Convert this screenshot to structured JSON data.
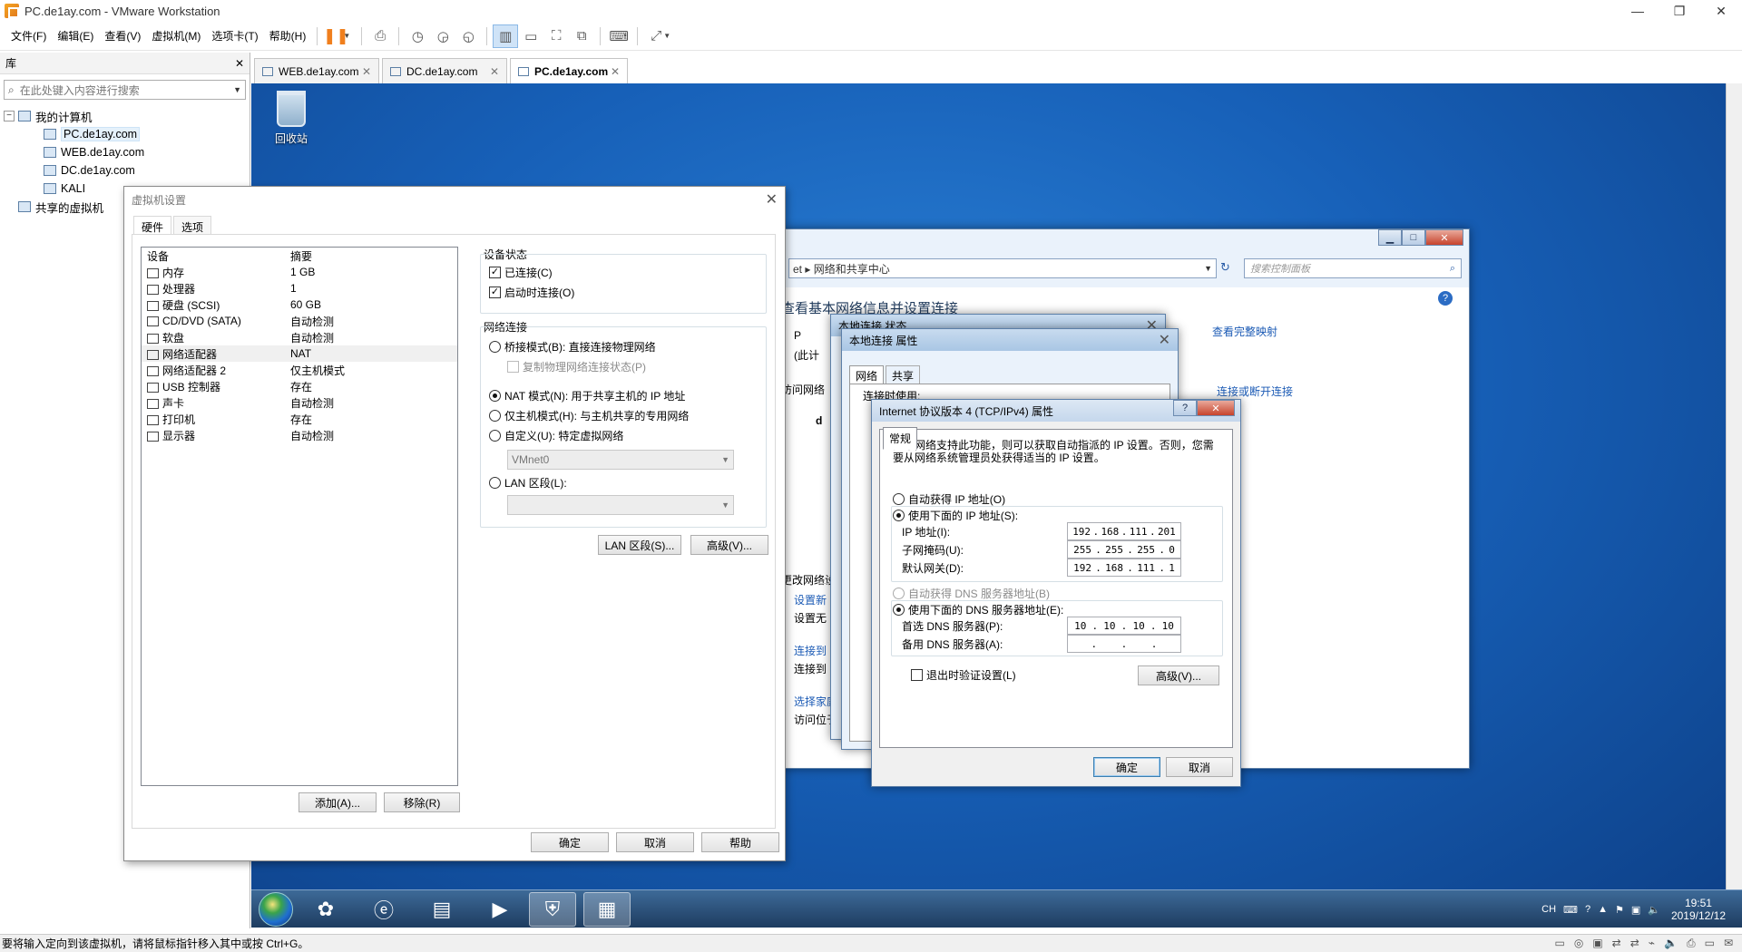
{
  "window": {
    "title": "PC.de1ay.com - VMware Workstation"
  },
  "menu": [
    "文件(F)",
    "编辑(E)",
    "查看(V)",
    "虚拟机(M)",
    "选项卡(T)",
    "帮助(H)"
  ],
  "library": {
    "title": "库",
    "search_placeholder": "在此处键入内容进行搜索",
    "root": "我的计算机",
    "vms": [
      "PC.de1ay.com",
      "WEB.de1ay.com",
      "DC.de1ay.com",
      "KALI"
    ],
    "shared": "共享的虚拟机"
  },
  "tabs": [
    "WEB.de1ay.com",
    "DC.de1ay.com",
    "PC.de1ay.com"
  ],
  "desktop": {
    "recycle_bin": "回收站"
  },
  "vm_settings": {
    "title": "虚拟机设置",
    "tabs": [
      "硬件",
      "选项"
    ],
    "col_device": "设备",
    "col_summary": "摘要",
    "devices": [
      {
        "name": "内存",
        "summary": "1 GB"
      },
      {
        "name": "处理器",
        "summary": "1"
      },
      {
        "name": "硬盘 (SCSI)",
        "summary": "60 GB"
      },
      {
        "name": "CD/DVD (SATA)",
        "summary": "自动检测"
      },
      {
        "name": "软盘",
        "summary": "自动检测"
      },
      {
        "name": "网络适配器",
        "summary": "NAT"
      },
      {
        "name": "网络适配器 2",
        "summary": "仅主机模式"
      },
      {
        "name": "USB 控制器",
        "summary": "存在"
      },
      {
        "name": "声卡",
        "summary": "自动检测"
      },
      {
        "name": "打印机",
        "summary": "存在"
      },
      {
        "name": "显示器",
        "summary": "自动检测"
      }
    ],
    "device_status": "设备状态",
    "connected": "已连接(C)",
    "connect_at_power_on": "启动时连接(O)",
    "net_conn": "网络连接",
    "bridged": "桥接模式(B): 直接连接物理网络",
    "replicate": "复制物理网络连接状态(P)",
    "nat": "NAT 模式(N): 用于共享主机的 IP 地址",
    "hostonly": "仅主机模式(H): 与主机共享的专用网络",
    "custom": "自定义(U): 特定虚拟网络",
    "vmnet": "VMnet0",
    "lan_segment": "LAN 区段(L):",
    "btn_lan": "LAN 区段(S)...",
    "btn_adv": "高级(V)...",
    "btn_add": "添加(A)...",
    "btn_remove": "移除(R)",
    "btn_ok": "确定",
    "btn_cancel": "取消",
    "btn_help": "帮助"
  },
  "ncs": {
    "addr": "et ▸ 网络和共享中心",
    "search": "搜索控制面板",
    "heading": "查看基本网络信息并设置连接",
    "full_map": "查看完整映射",
    "connect_or_disconnect": "连接或断开连接",
    "change_settings": "更改网络设置",
    "partials": [
      "P",
      "(此计",
      "访问网络",
      "d",
      "设置新",
      "设置无",
      "连接到",
      "连接到",
      "选择家庭",
      "访问位于其他"
    ]
  },
  "lan_status": {
    "title": "本地连接 状态"
  },
  "lan_prop": {
    "title": "本地连接 属性",
    "tabs": [
      "网络",
      "共享"
    ],
    "connect_using": "连接时使用:"
  },
  "ipv4": {
    "title": "Internet 协议版本 4 (TCP/IPv4) 属性",
    "tab": "常规",
    "desc": "如果网络支持此功能，则可以获取自动指派的 IP 设置。否则，您需要从网络系统管理员处获得适当的 IP 设置。",
    "auto_ip": "自动获得 IP 地址(O)",
    "manual_ip": "使用下面的 IP 地址(S):",
    "ip_label": "IP 地址(I):",
    "ip": [
      "192",
      "168",
      "111",
      "201"
    ],
    "mask_label": "子网掩码(U):",
    "mask": [
      "255",
      "255",
      "255",
      "0"
    ],
    "gw_label": "默认网关(D):",
    "gw": [
      "192",
      "168",
      "111",
      "1"
    ],
    "auto_dns": "自动获得 DNS 服务器地址(B)",
    "manual_dns": "使用下面的 DNS 服务器地址(E):",
    "dns1_label": "首选 DNS 服务器(P):",
    "dns1": [
      "10",
      "10",
      "10",
      "10"
    ],
    "dns2_label": "备用 DNS 服务器(A):",
    "validate": "退出时验证设置(L)",
    "btn_adv": "高级(V)...",
    "btn_ok": "确定",
    "btn_cancel": "取消"
  },
  "taskbar": {
    "lang": "CH",
    "time": "19:51",
    "date": "2019/12/12"
  },
  "statusbar": {
    "hint": "要将输入定向到该虚拟机，请将鼠标指针移入其中或按 Ctrl+G。"
  }
}
